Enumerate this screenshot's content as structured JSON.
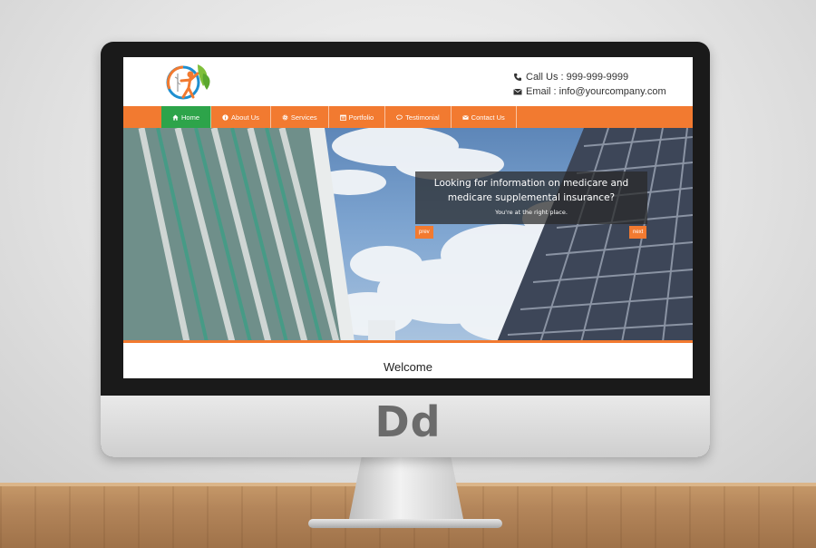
{
  "display": {
    "chin_logo": "Dd"
  },
  "website": {
    "contact": {
      "phone": "Call Us : 999-999-9999",
      "email": "Email : info@yourcompany.com"
    },
    "nav": [
      {
        "label": "Home",
        "icon": "home-icon",
        "active": true
      },
      {
        "label": "About Us",
        "icon": "info-icon",
        "active": false
      },
      {
        "label": "Services",
        "icon": "gear-icon",
        "active": false
      },
      {
        "label": "Portfolio",
        "icon": "calendar-icon",
        "active": false
      },
      {
        "label": "Testimonial",
        "icon": "comments-icon",
        "active": false
      },
      {
        "label": "Contact Us",
        "icon": "envelope-icon",
        "active": false
      }
    ],
    "slider": {
      "heading": "Looking for information on medicare and medicare supplemental insurance?",
      "subtext": "You're at the right place.",
      "prev_label": "prev",
      "next_label": "next"
    },
    "welcome": "Welcome"
  },
  "colors": {
    "accent_orange": "#f27a30",
    "active_green": "#2da44a"
  }
}
